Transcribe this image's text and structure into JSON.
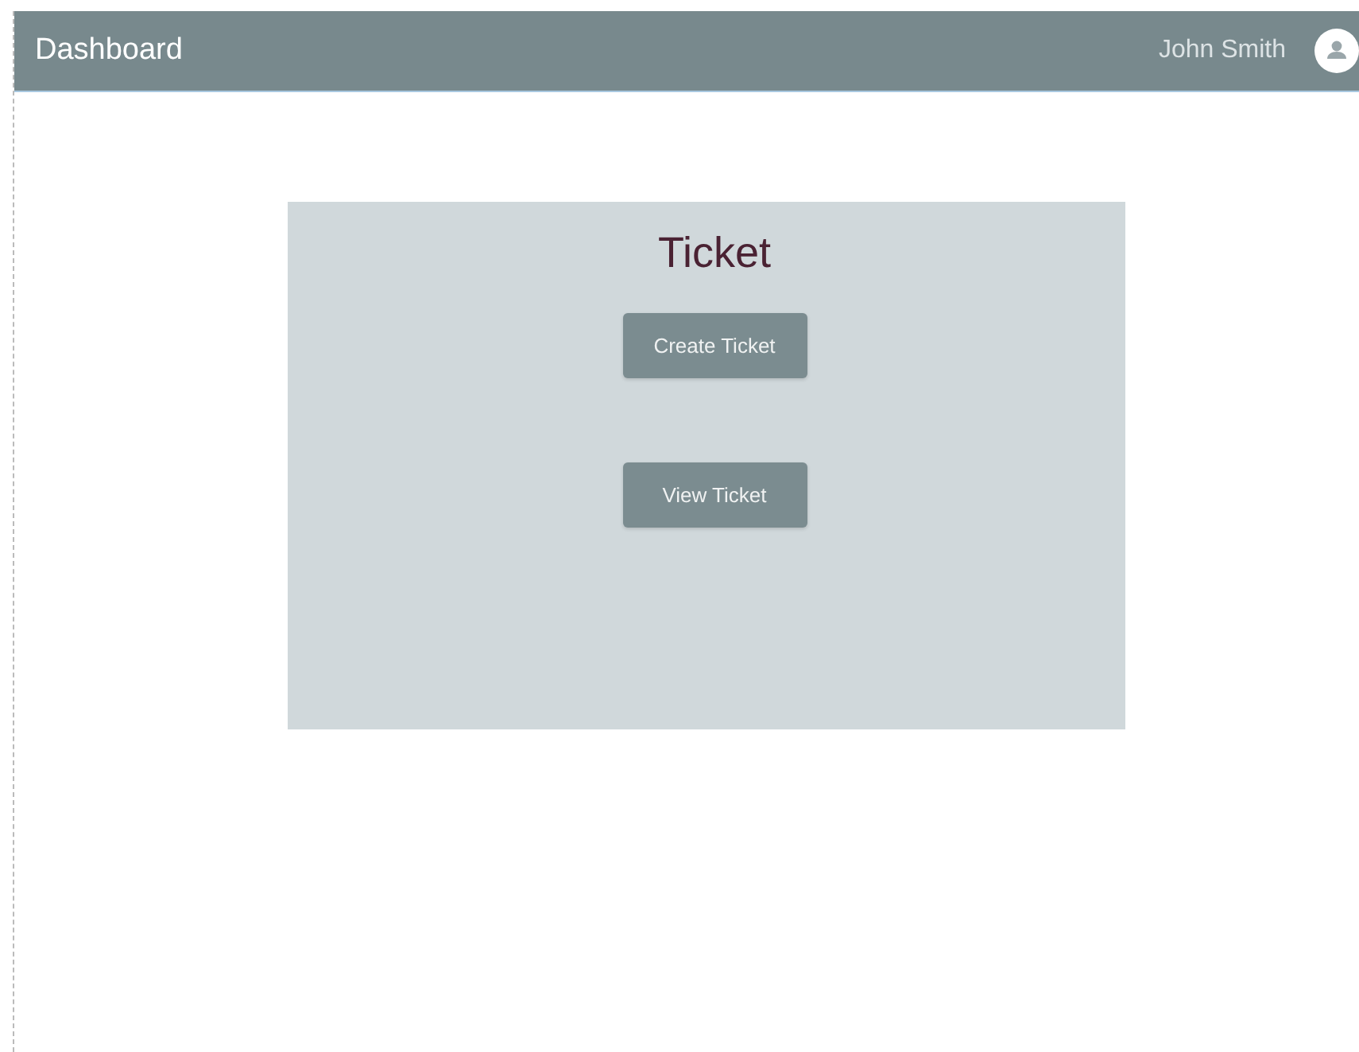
{
  "header": {
    "title": "Dashboard",
    "user_name": "John Smith"
  },
  "panel": {
    "title": "Ticket",
    "buttons": [
      "Create Ticket",
      "View Ticket"
    ]
  }
}
